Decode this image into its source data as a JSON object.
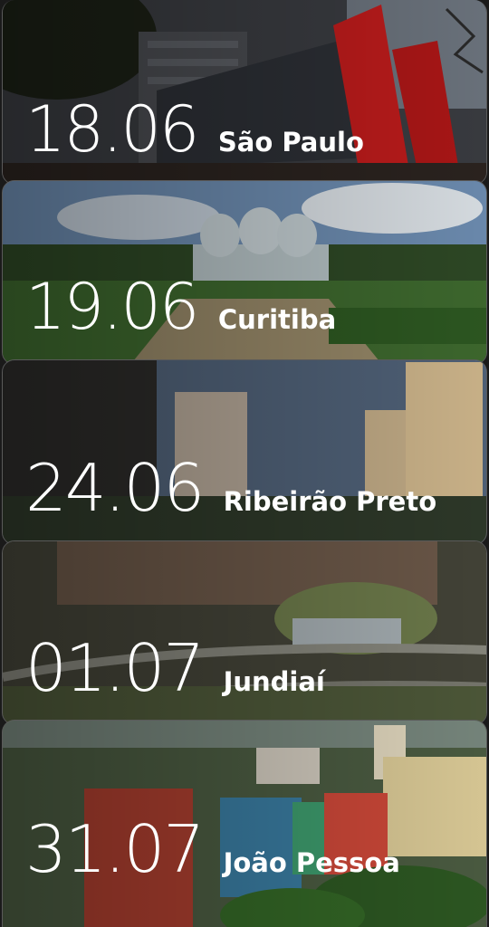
{
  "events": [
    {
      "date": "18.06",
      "city": "São Paulo"
    },
    {
      "date": "19.06",
      "city": "Curitiba"
    },
    {
      "date": "24.06",
      "city": "Ribeirão Preto"
    },
    {
      "date": "01.07",
      "city": "Jundiaí"
    },
    {
      "date": "31.07",
      "city": "João Pessoa"
    }
  ]
}
